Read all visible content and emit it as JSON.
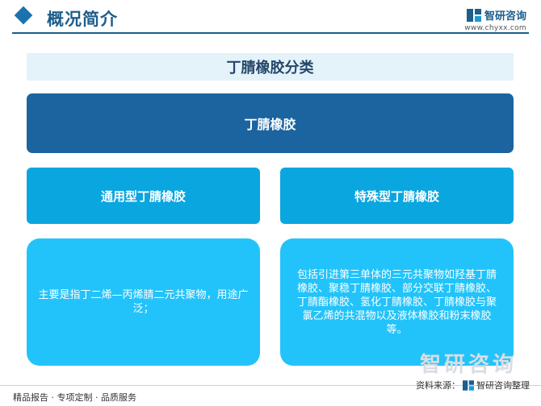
{
  "header": {
    "title": "概况简介",
    "brand_name": "智研咨询",
    "brand_url": "www.chyxx.com"
  },
  "diagram": {
    "title": "丁腈橡胶分类",
    "root": "丁腈橡胶",
    "categories": [
      {
        "label": "通用型丁腈橡胶",
        "description": "主要是指丁二烯—丙烯腈二元共聚物，用途广泛；"
      },
      {
        "label": "特殊型丁腈橡胶",
        "description": "包括引进第三单体的三元共聚物如羟基丁腈橡胶、聚稳丁腈橡胶、部分交联丁腈橡胶、丁腈酯橡胶、氢化丁腈橡胶、丁腈橡胶与聚氯乙烯的共混物以及液体橡胶和粉末橡胶等。"
      }
    ]
  },
  "watermark": "智研咨询",
  "footer": {
    "left": "精品报告 · 专项定制 · 品质服务",
    "source_prefix": "资料来源：",
    "source_suffix": "智研咨询整理"
  },
  "colors": {
    "primary": "#1b64a0",
    "category": "#0aa6e0",
    "description": "#22c3fa",
    "title_bar": "#e4f2fa"
  }
}
